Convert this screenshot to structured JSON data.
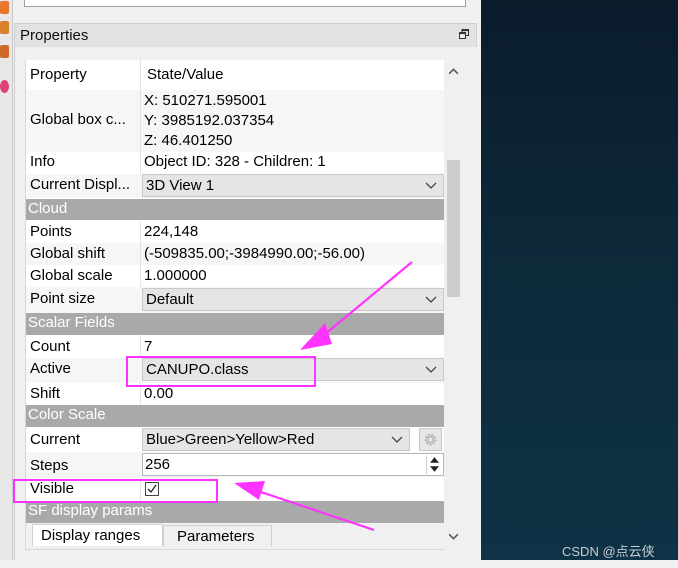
{
  "panel": {
    "title": "Properties",
    "float_icon": "float-restore-icon"
  },
  "table": {
    "header": {
      "col1": "Property",
      "col2": "State/Value"
    },
    "global_box": {
      "label": "Global box c...",
      "x": "X: 510271.595001",
      "y": "Y: 3985192.037354",
      "z": "Z: 46.401250"
    },
    "info": {
      "label": "Info",
      "value": "Object ID: 328 - Children: 1"
    },
    "current_display": {
      "label": "Current Displ...",
      "value": "3D View 1"
    },
    "cloud_section": "Cloud",
    "points": {
      "label": "Points",
      "value": "224,148"
    },
    "global_shift": {
      "label": "Global shift",
      "value": "(-509835.00;-3984990.00;-56.00)"
    },
    "global_scale": {
      "label": "Global scale",
      "value": "1.000000"
    },
    "point_size": {
      "label": "Point size",
      "value": "Default"
    },
    "scalar_section": "Scalar Fields",
    "count": {
      "label": "Count",
      "value": "7"
    },
    "active": {
      "label": "Active",
      "value": "CANUPO.class"
    },
    "shift": {
      "label": "Shift",
      "value": "0.00"
    },
    "color_scale_section": "Color Scale",
    "current": {
      "label": "Current",
      "value": "Blue>Green>Yellow>Red"
    },
    "steps": {
      "label": "Steps",
      "value": "256"
    },
    "visible": {
      "label": "Visible",
      "checked": true
    },
    "sf_section": "SF display params",
    "tabs": [
      "Display ranges",
      "Parameters"
    ]
  },
  "watermark": "CSDN @点云侠",
  "colors": {
    "annotation": "#ff33ff",
    "section_bg": "#a9a9a9",
    "viewport": "#0d2a3b"
  }
}
